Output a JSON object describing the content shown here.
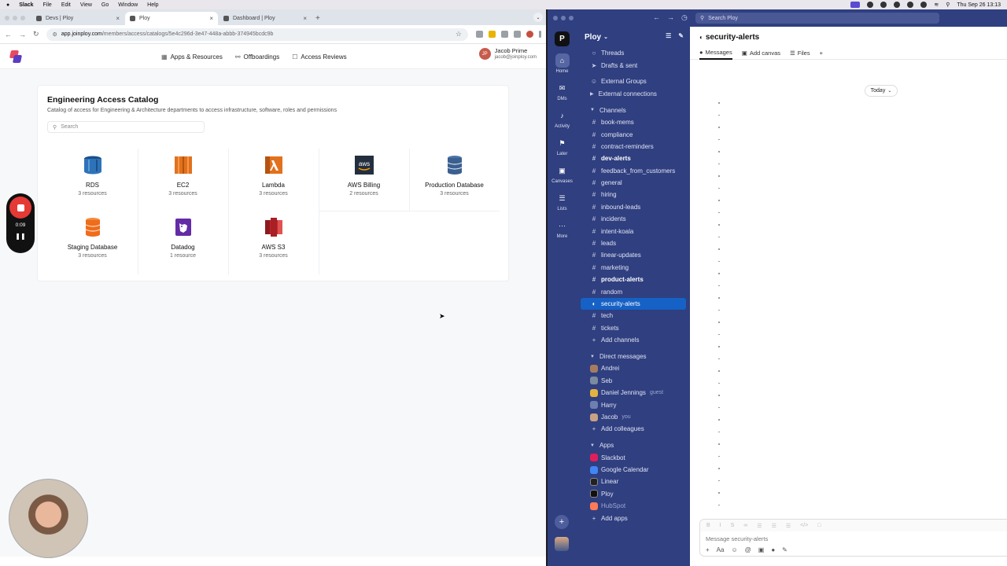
{
  "menubar": {
    "app": "Slack",
    "items": [
      "File",
      "Edit",
      "View",
      "Go",
      "Window",
      "Help"
    ],
    "clock": "Thu Sep 26  13:13"
  },
  "chrome": {
    "tabs": [
      {
        "title": "Devs | Ploy"
      },
      {
        "title": "Ploy"
      },
      {
        "title": "Dashboard | Ploy"
      }
    ],
    "url_host": "app.joinploy.com",
    "url_path": "/members/access/catalogs/5e4c296d-3e47-448a-abbb-374945bcdc9b"
  },
  "ploy": {
    "nav": [
      {
        "label": "Apps & Resources",
        "icon": "grid-icon"
      },
      {
        "label": "Offboardings",
        "icon": "user-minus-icon"
      },
      {
        "label": "Access Reviews",
        "icon": "lock-icon"
      }
    ],
    "user": {
      "initials": "JP",
      "name": "Jacob Prime",
      "email": "jacob@joinploy.com"
    },
    "catalog": {
      "title": "Engineering Access Catalog",
      "description": "Catalog of access for Engineering & Architecture departments to access infrastructure, software, roles and permissions",
      "search_placeholder": "Search",
      "items": [
        {
          "name": "RDS",
          "count": "3 resources",
          "color": "#2e73b8"
        },
        {
          "name": "EC2",
          "count": "3 resources",
          "color": "#e2711d"
        },
        {
          "name": "Lambda",
          "count": "3 resources",
          "color": "#e2711d"
        },
        {
          "name": "AWS Billing",
          "count": "2 resources",
          "color": "#232f3e"
        },
        {
          "name": "Production Database",
          "count": "3 resources",
          "color": "#3b5f8f"
        },
        {
          "name": "Staging Database",
          "count": "3 resources",
          "color": "#ef6c1a"
        },
        {
          "name": "Datadog",
          "count": "1 resource",
          "color": "#632ca6"
        },
        {
          "name": "AWS S3",
          "count": "3 resources",
          "color": "#c7242b"
        }
      ]
    }
  },
  "recorder": {
    "time": "0:09"
  },
  "slack": {
    "search_placeholder": "Search Ploy",
    "workspace": "Ploy",
    "rail": [
      {
        "label": "Home",
        "icon": "home-icon"
      },
      {
        "label": "DMs",
        "icon": "dm-icon"
      },
      {
        "label": "Activity",
        "icon": "bell-icon"
      },
      {
        "label": "Later",
        "icon": "bookmark-icon"
      },
      {
        "label": "Canvases",
        "icon": "canvas-icon"
      },
      {
        "label": "Lists",
        "icon": "list-icon"
      },
      {
        "label": "More",
        "icon": "more-icon"
      }
    ],
    "top_items": [
      {
        "label": "Threads",
        "icon": "threads-icon"
      },
      {
        "label": "Drafts & sent",
        "icon": "send-icon"
      }
    ],
    "external": [
      {
        "label": "External Groups"
      },
      {
        "label": "External connections"
      }
    ],
    "channels_header": "Channels",
    "channels": [
      {
        "name": "book-mems"
      },
      {
        "name": "compliance"
      },
      {
        "name": "contract-reminders"
      },
      {
        "name": "dev-alerts",
        "bold": true
      },
      {
        "name": "feedback_from_customers"
      },
      {
        "name": "general"
      },
      {
        "name": "hiring"
      },
      {
        "name": "inbound-leads"
      },
      {
        "name": "incidents"
      },
      {
        "name": "intent-koala"
      },
      {
        "name": "leads"
      },
      {
        "name": "linear-updates"
      },
      {
        "name": "marketing"
      },
      {
        "name": "product-alerts",
        "bold": true
      },
      {
        "name": "random"
      },
      {
        "name": "security-alerts",
        "selected": true,
        "private": true
      },
      {
        "name": "tech"
      },
      {
        "name": "tickets"
      }
    ],
    "add_channels": "Add channels",
    "dm_header": "Direct messages",
    "dms": [
      {
        "name": "Andrei",
        "note": ""
      },
      {
        "name": "Seb",
        "note": ""
      },
      {
        "name": "Daniel Jennings",
        "note": "guest"
      },
      {
        "name": "Harry",
        "note": ""
      },
      {
        "name": "Jacob",
        "note": "you"
      }
    ],
    "add_colleagues": "Add colleagues",
    "apps_header": "Apps",
    "apps": [
      {
        "name": "Slackbot",
        "color": "#e01e5a"
      },
      {
        "name": "Google Calendar",
        "color": "#4285f4"
      },
      {
        "name": "Linear",
        "color": "#222222"
      },
      {
        "name": "Ploy",
        "color": "#111111"
      },
      {
        "name": "HubSpot",
        "color": "#ff7a59",
        "muted": true
      }
    ],
    "add_apps": "Add apps",
    "channel": {
      "name": "security-alerts",
      "tabs": [
        "Messages",
        "Add canvas",
        "Files"
      ],
      "date_divider": "Today",
      "composer_placeholder": "Message  security-alerts"
    }
  }
}
